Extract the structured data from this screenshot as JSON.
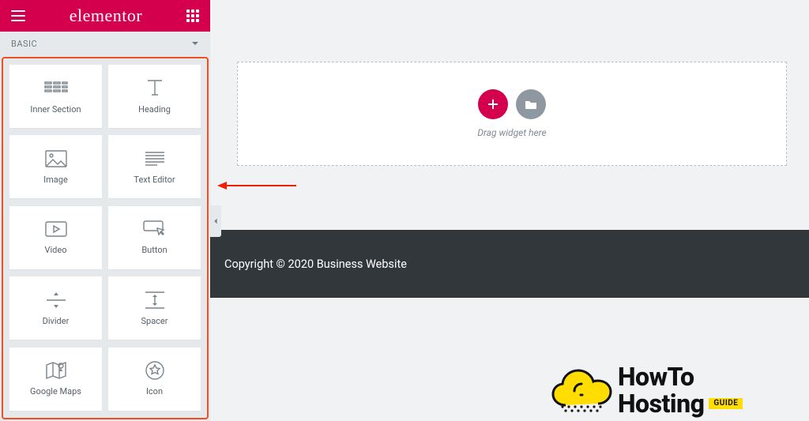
{
  "header": {
    "brand": "elementor"
  },
  "category": {
    "label": "BASIC"
  },
  "widgets": [
    {
      "id": "inner-section",
      "label": "Inner Section"
    },
    {
      "id": "heading",
      "label": "Heading"
    },
    {
      "id": "image",
      "label": "Image"
    },
    {
      "id": "text-editor",
      "label": "Text Editor"
    },
    {
      "id": "video",
      "label": "Video"
    },
    {
      "id": "button",
      "label": "Button"
    },
    {
      "id": "divider",
      "label": "Divider"
    },
    {
      "id": "spacer",
      "label": "Spacer"
    },
    {
      "id": "google-maps",
      "label": "Google Maps"
    },
    {
      "id": "icon",
      "label": "Icon"
    }
  ],
  "dropzone": {
    "hint": "Drag widget here"
  },
  "footer": {
    "copyright": "Copyright © 2020 Business Website"
  },
  "watermark": {
    "line1": "HowTo",
    "line2": "Hosting",
    "badge": "GUIDE"
  },
  "colors": {
    "accent": "#d4004d",
    "highlight": "#f04e23",
    "panel": "#e6e9ec",
    "canvas": "#f1f2f3",
    "footer": "#32373c",
    "yellow": "#ffdd00"
  }
}
